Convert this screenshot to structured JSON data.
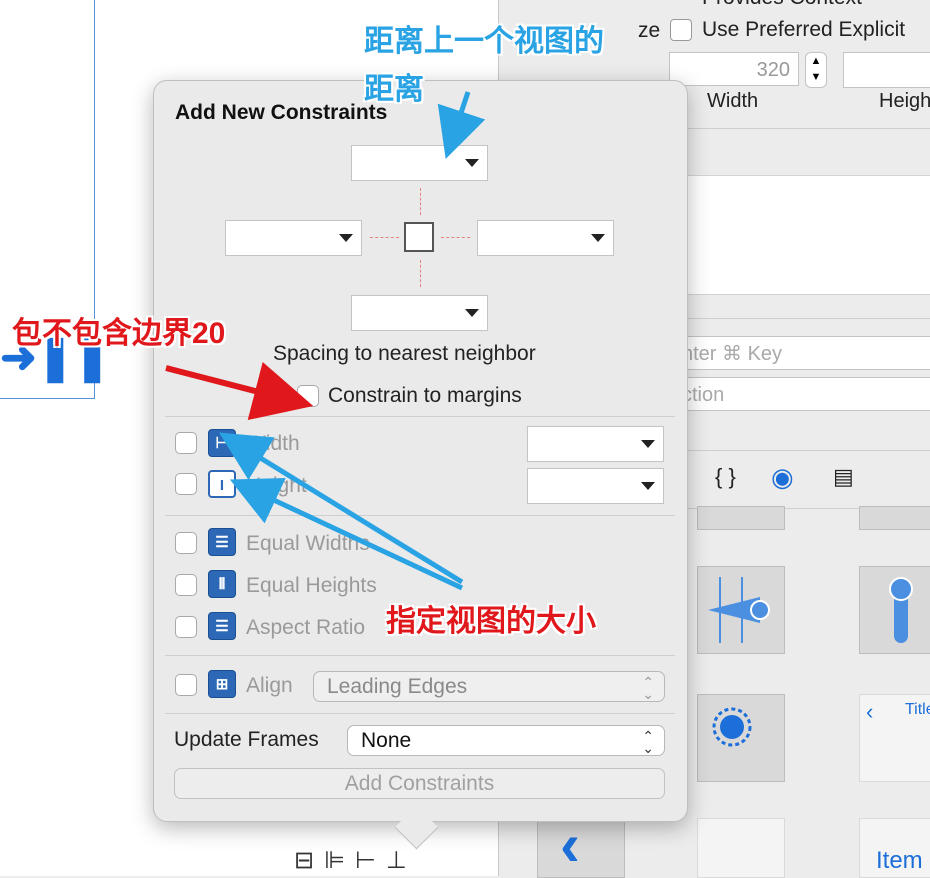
{
  "inspector": {
    "provides_context_label": "Provides Context",
    "size_truncated": "ze",
    "use_preferred_label": "Use Preferred Explicit",
    "width_value": "320",
    "width_label": "Width",
    "height_label": "Heigh",
    "key_placeholder": "nter ⌘ Key",
    "action_placeholder": "ction",
    "library_item_title": "Title",
    "library_item_label": "Item"
  },
  "popover": {
    "title": "Add New Constraints",
    "spacing_caption": "Spacing to nearest neighbor",
    "constrain_margins_label": "Constrain to margins",
    "width_label": "Width",
    "height_label": "Height",
    "equal_widths_label": "Equal Widths",
    "equal_heights_label": "Equal Heights",
    "aspect_ratio_label": "Aspect Ratio",
    "align_label": "Align",
    "align_value": "Leading Edges",
    "update_frames_label": "Update Frames",
    "update_frames_value": "None",
    "add_button_label": "Add Constraints"
  },
  "annotations": {
    "top_spacing": "距离上一个视图的",
    "top_spacing_line2": "距离",
    "margins_note": "包不包含边界20",
    "size_note": "指定视图的大小"
  },
  "colors": {
    "annotation_blue": "#29a3e3",
    "annotation_red": "#e0181c",
    "constraint_icon": "#2c68b6",
    "spacer_dashes": "#e4857d"
  }
}
